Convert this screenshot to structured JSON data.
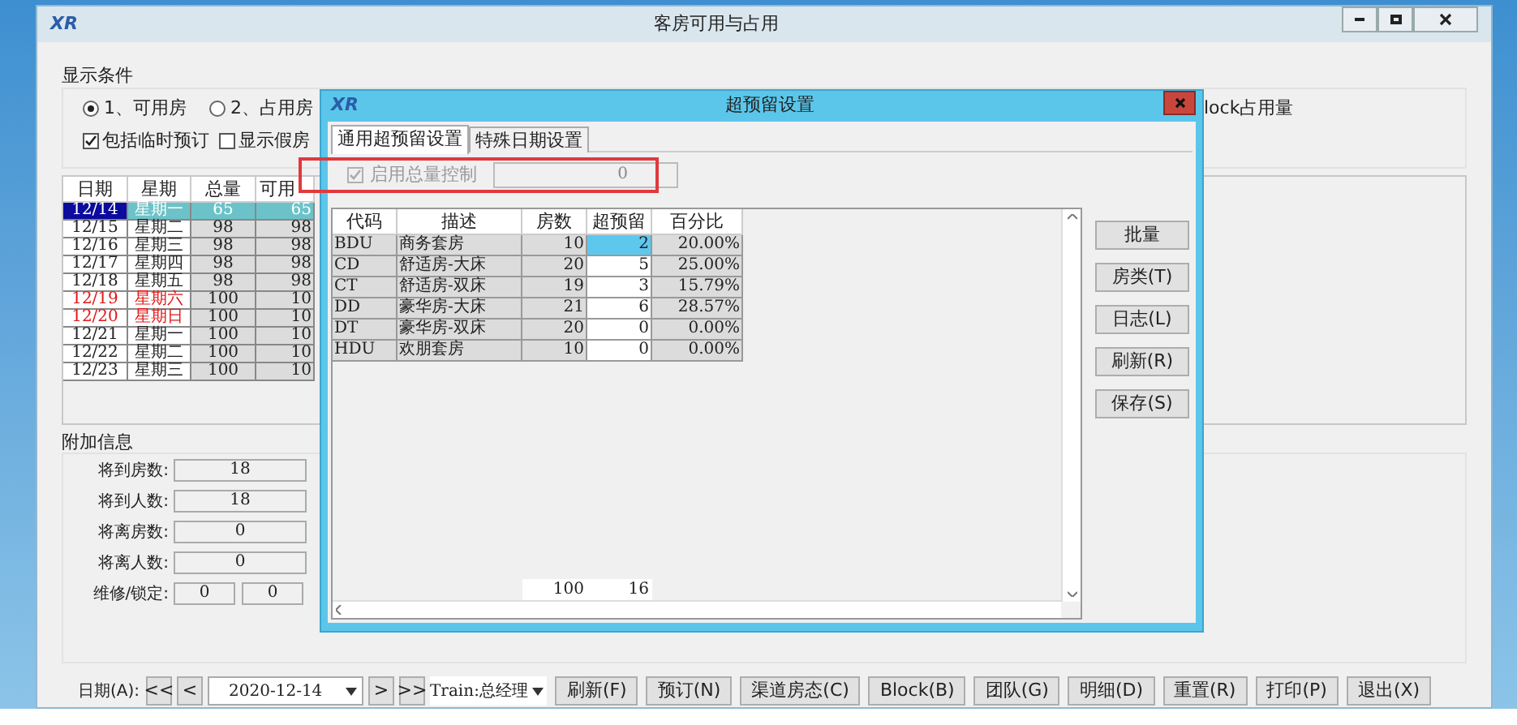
{
  "window": {
    "logo": "XR",
    "title": "客房可用与占用"
  },
  "display_conditions": {
    "title": "显示条件",
    "radios": [
      {
        "label": "1、可用房",
        "selected": true
      },
      {
        "label": "2、占用房",
        "selected": false
      }
    ],
    "checkboxes": [
      {
        "label": "包括临时预订",
        "checked": true
      },
      {
        "label": "显示假房",
        "checked": false
      }
    ],
    "partial_label": "lock占用量"
  },
  "availability_table": {
    "columns": [
      "日期",
      "星期",
      "总量",
      "可用"
    ],
    "rows": [
      {
        "cells": [
          "12/14",
          "星期一",
          "65",
          "65"
        ],
        "selected": true,
        "weekend": false
      },
      {
        "cells": [
          "12/15",
          "星期二",
          "98",
          "98"
        ],
        "selected": false,
        "weekend": false
      },
      {
        "cells": [
          "12/16",
          "星期三",
          "98",
          "98"
        ],
        "selected": false,
        "weekend": false
      },
      {
        "cells": [
          "12/17",
          "星期四",
          "98",
          "98"
        ],
        "selected": false,
        "weekend": false
      },
      {
        "cells": [
          "12/18",
          "星期五",
          "98",
          "98"
        ],
        "selected": false,
        "weekend": false
      },
      {
        "cells": [
          "12/19",
          "星期六",
          "100",
          "10"
        ],
        "selected": false,
        "weekend": true
      },
      {
        "cells": [
          "12/20",
          "星期日",
          "100",
          "10"
        ],
        "selected": false,
        "weekend": true
      },
      {
        "cells": [
          "12/21",
          "星期一",
          "100",
          "10"
        ],
        "selected": false,
        "weekend": false
      },
      {
        "cells": [
          "12/22",
          "星期二",
          "100",
          "10"
        ],
        "selected": false,
        "weekend": false
      },
      {
        "cells": [
          "12/23",
          "星期三",
          "100",
          "10"
        ],
        "selected": false,
        "weekend": false
      }
    ]
  },
  "extra_info": {
    "title": "附加信息",
    "fields": [
      {
        "label": "将到房数:",
        "values": [
          "18"
        ]
      },
      {
        "label": "将到人数:",
        "values": [
          "18"
        ]
      },
      {
        "label": "将离房数:",
        "values": [
          "0"
        ]
      },
      {
        "label": "将离人数:",
        "values": [
          "0"
        ]
      },
      {
        "label": "维修/锁定:",
        "values": [
          "0",
          "0"
        ]
      }
    ]
  },
  "bottom_bar": {
    "date_label": "日期(A):",
    "nav_back": [
      "<<",
      "<"
    ],
    "date": "2020-12-14",
    "nav_forward": [
      ">",
      ">>"
    ],
    "user": "Train:总经理",
    "buttons": [
      "刷新(F)",
      "预订(N)",
      "渠道房态(C)",
      "Block(B)",
      "团队(G)",
      "明细(D)",
      "重置(R)",
      "打印(P)",
      "退出(X)"
    ]
  },
  "dialog": {
    "logo": "XR",
    "title": "超预留设置",
    "tabs": [
      {
        "label": "通用超预留设置",
        "selected": true
      },
      {
        "label": "特殊日期设置",
        "selected": false
      }
    ],
    "total_control": {
      "label": "启用总量控制",
      "checked": true,
      "disabled": true,
      "value": "0"
    },
    "table": {
      "columns": [
        "代码",
        "描述",
        "房数",
        "超预留",
        "百分比"
      ],
      "rows": [
        {
          "code": "BDU",
          "description": "商务套房",
          "rooms": "10",
          "overbooking": "2",
          "percent": "20.00%",
          "selected": true
        },
        {
          "code": "CD",
          "description": "舒适房-大床",
          "rooms": "20",
          "overbooking": "5",
          "percent": "25.00%",
          "selected": false
        },
        {
          "code": "CT",
          "description": "舒适房-双床",
          "rooms": "19",
          "overbooking": "3",
          "percent": "15.79%",
          "selected": false
        },
        {
          "code": "DD",
          "description": "豪华房-大床",
          "rooms": "21",
          "overbooking": "6",
          "percent": "28.57%",
          "selected": false
        },
        {
          "code": "DT",
          "description": "豪华房-双床",
          "rooms": "20",
          "overbooking": "0",
          "percent": "0.00%",
          "selected": false
        },
        {
          "code": "HDU",
          "description": "欢朋套房",
          "rooms": "10",
          "overbooking": "0",
          "percent": "0.00%",
          "selected": false
        }
      ],
      "totals": [
        "100",
        "16"
      ]
    },
    "buttons": [
      "批量",
      "房类(T)",
      "日志(L)",
      "刷新(R)",
      "保存(S)"
    ]
  }
}
